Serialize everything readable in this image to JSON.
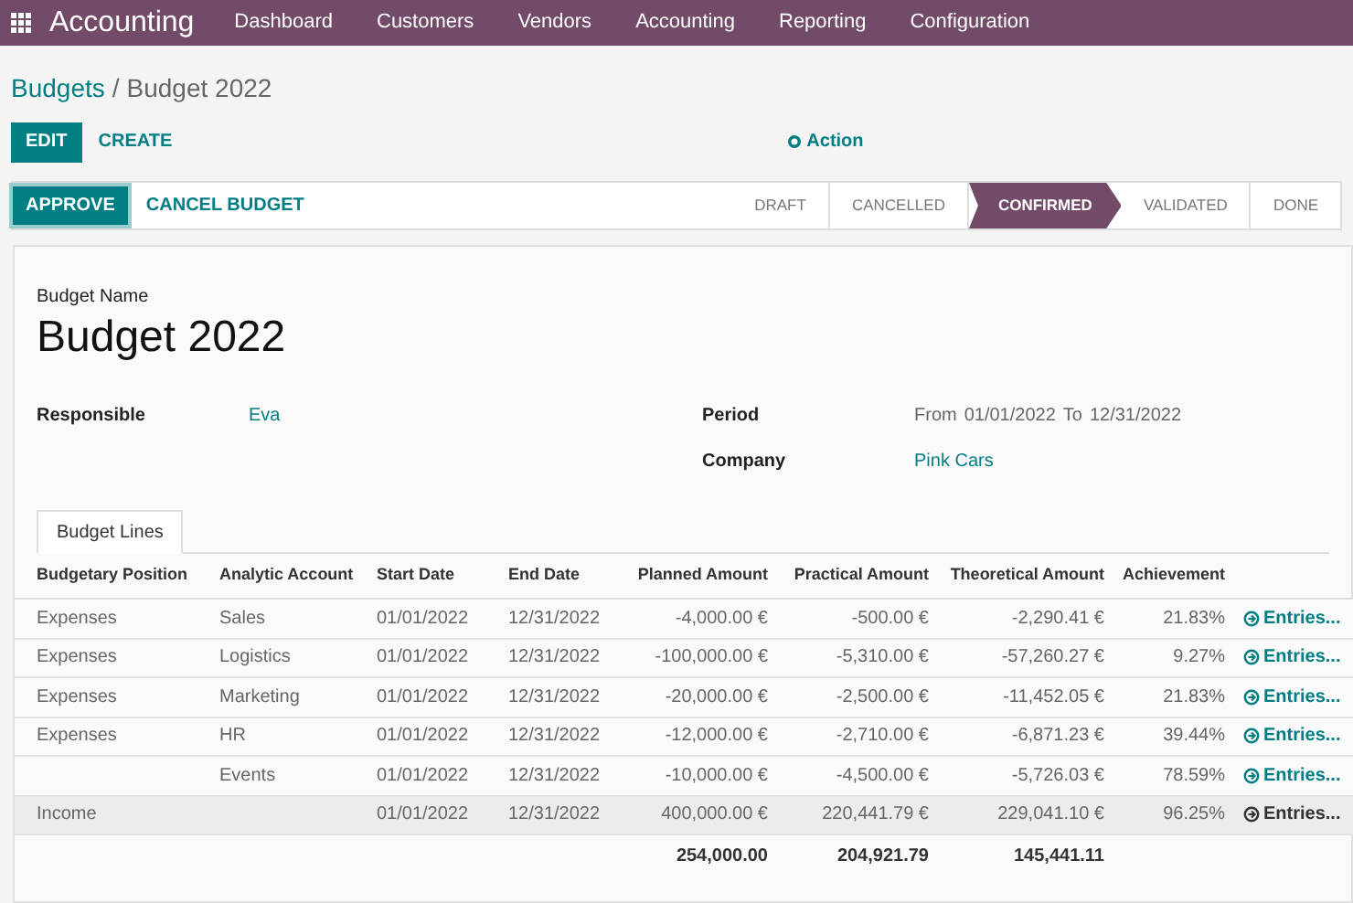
{
  "navbar": {
    "app_title": "Accounting",
    "menu": [
      "Dashboard",
      "Customers",
      "Vendors",
      "Accounting",
      "Reporting",
      "Configuration"
    ]
  },
  "breadcrumb": {
    "parent": "Budgets",
    "separator": "/",
    "current": "Budget 2022"
  },
  "control_buttons": {
    "edit": "EDIT",
    "create": "CREATE",
    "action": "Action"
  },
  "status_bar": {
    "buttons": [
      "APPROVE",
      "CANCEL BUDGET"
    ],
    "stages": [
      {
        "label": "DRAFT",
        "selected": false
      },
      {
        "label": "CANCELLED",
        "selected": false
      },
      {
        "label": "CONFIRMED",
        "selected": true
      },
      {
        "label": "VALIDATED",
        "selected": false
      },
      {
        "label": "DONE",
        "selected": false
      }
    ]
  },
  "form": {
    "name_label": "Budget Name",
    "name": "Budget 2022",
    "fields_left": [
      {
        "label": "Responsible",
        "value": "Eva"
      }
    ],
    "period": {
      "label": "Period",
      "from_label": "From",
      "from": "01/01/2022",
      "to_label": "To",
      "to": "12/31/2022"
    },
    "company": {
      "label": "Company",
      "value": "Pink Cars"
    }
  },
  "tabs": [
    {
      "label": "Budget Lines",
      "selected": true
    }
  ],
  "table": {
    "columns": [
      "Budgetary Position",
      "Analytic Account",
      "Start Date",
      "End Date",
      "Planned Amount",
      "Practical Amount",
      "Theoretical Amount",
      "Achievement"
    ],
    "rows": [
      {
        "position": "Expenses",
        "account": "Sales",
        "start": "01/01/2022",
        "end": "12/31/2022",
        "planned": "-4,000.00 €",
        "practical": "-500.00 €",
        "theoretical": "-2,290.41 €",
        "achievement": "21.83%",
        "link": "Entries...",
        "hovered": false
      },
      {
        "position": "Expenses",
        "account": "Logistics",
        "start": "01/01/2022",
        "end": "12/31/2022",
        "planned": "-100,000.00 €",
        "practical": "-5,310.00 €",
        "theoretical": "-57,260.27 €",
        "achievement": "9.27%",
        "link": "Entries...",
        "hovered": false
      },
      {
        "position": "Expenses",
        "account": "Marketing",
        "start": "01/01/2022",
        "end": "12/31/2022",
        "planned": "-20,000.00 €",
        "practical": "-2,500.00 €",
        "theoretical": "-11,452.05 €",
        "achievement": "21.83%",
        "link": "Entries...",
        "hovered": false
      },
      {
        "position": "Expenses",
        "account": "HR",
        "start": "01/01/2022",
        "end": "12/31/2022",
        "planned": "-12,000.00 €",
        "practical": "-2,710.00 €",
        "theoretical": "-6,871.23 €",
        "achievement": "39.44%",
        "link": "Entries...",
        "hovered": false
      },
      {
        "position": "",
        "account": "Events",
        "start": "01/01/2022",
        "end": "12/31/2022",
        "planned": "-10,000.00 €",
        "practical": "-4,500.00 €",
        "theoretical": "-5,726.03 €",
        "achievement": "78.59%",
        "link": "Entries...",
        "hovered": false
      },
      {
        "position": "Income",
        "account": "",
        "start": "01/01/2022",
        "end": "12/31/2022",
        "planned": "400,000.00 €",
        "practical": "220,441.79 €",
        "theoretical": "229,041.10 €",
        "achievement": "96.25%",
        "link": "Entries...",
        "hovered": true
      }
    ],
    "totals": {
      "planned": "254,000.00",
      "practical": "204,921.79",
      "theoretical": "145,441.11"
    }
  }
}
